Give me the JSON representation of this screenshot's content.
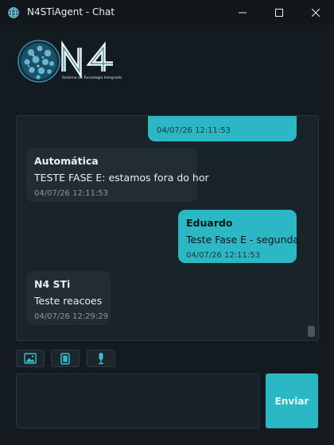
{
  "window": {
    "title": "N4STiAgent - Chat"
  },
  "logo": {
    "mark": "N4",
    "tagline": "Sistema de Tecnologia Integrada"
  },
  "messages": [
    {
      "direction": "out",
      "sender": "",
      "text": "",
      "timestamp": "04/07/26 12:11:53"
    },
    {
      "direction": "in",
      "sender": "Automática",
      "text": "TESTE FASE E: estamos fora do hor",
      "timestamp": "04/07/26 12:11:53"
    },
    {
      "direction": "out",
      "sender": "Eduardo",
      "text": "Teste Fase E - segunda",
      "timestamp": "04/07/26 12:11:53"
    },
    {
      "direction": "in",
      "sender": "N4 STi",
      "text": "Teste reacoes",
      "timestamp": "04/07/26 12:29:29"
    }
  ],
  "toolbar": {
    "image_icon": "image-icon",
    "document_icon": "document-icon",
    "microphone_icon": "microphone-icon"
  },
  "composer": {
    "value": "",
    "placeholder": "",
    "send_label": "Enviar"
  },
  "colors": {
    "background": "#141b20",
    "accent": "#2cb7c4",
    "incoming_bubble": "#212c33"
  }
}
